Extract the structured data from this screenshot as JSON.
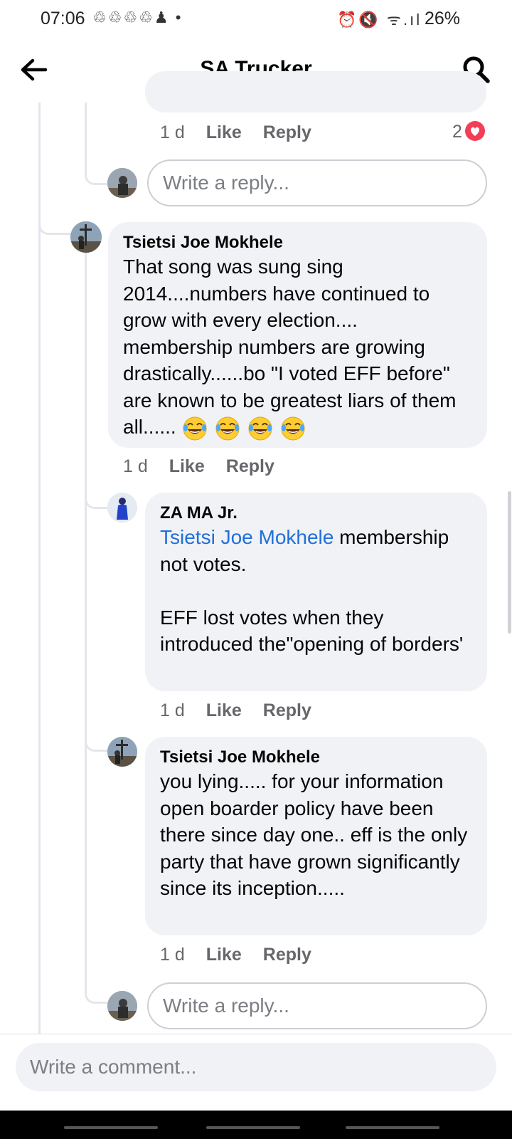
{
  "status": {
    "time": "07:06",
    "left_icons": "♲♲♲♲♟ •",
    "right_icons": "⏰🔇 ᯤ.ıl",
    "battery": "26%"
  },
  "header": {
    "title": "SA Trucker",
    "back_icon": "arrow-left-icon",
    "search_icon": "search-icon"
  },
  "top_comment_tail": {
    "age": "1 d",
    "like": "Like",
    "reply": "Reply",
    "reaction_count": "2"
  },
  "reply_placeholder": "Write a reply...",
  "comments": [
    {
      "author": "Tsietsi Joe Mokhele",
      "text": "That song was sung sing 2014....numbers have continued to grow with every election.... membership numbers are growing drastically......bo \"I voted EFF before\" are known to be greatest liars of them all......",
      "emoji_count": 4,
      "age": "1 d",
      "like": "Like",
      "reply": "Reply"
    },
    {
      "author": "ZA MA Jr.",
      "mention": "Tsietsi Joe Mokhele",
      "text": " membership not votes.\n\nEFF lost votes when they introduced the\"opening of borders'",
      "age": "1 d",
      "like": "Like",
      "reply": "Reply"
    },
    {
      "author": "Tsietsi Joe Mokhele",
      "text": "you lying..... for your information open boarder policy have been there since day one.. eff is the only party that have grown significantly since its inception.....",
      "age": "1 d",
      "like": "Like",
      "reply": "Reply"
    }
  ],
  "comment_placeholder": "Write a comment...",
  "colors": {
    "bubble": "#f0f2f5",
    "mention": "#216fdb",
    "heart": "#f33e58"
  }
}
